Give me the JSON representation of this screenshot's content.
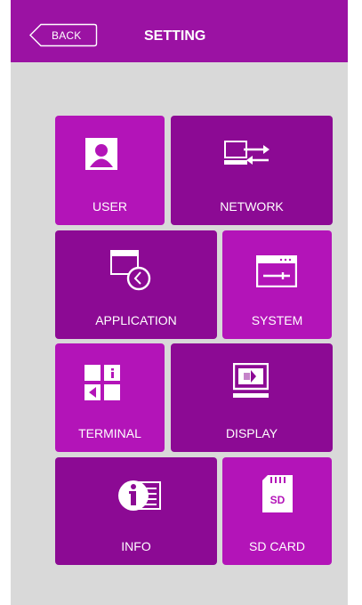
{
  "header": {
    "back_label": "BACK",
    "title": "SETTING",
    "background": "#9b12a3"
  },
  "tiles": [
    {
      "label": "USER",
      "icon": "user-icon"
    },
    {
      "label": "NETWORK",
      "icon": "network-icon"
    },
    {
      "label": "APPLICATION",
      "icon": "application-icon"
    },
    {
      "label": "SYSTEM",
      "icon": "system-icon"
    },
    {
      "label": "TERMINAL",
      "icon": "terminal-icon"
    },
    {
      "label": "DISPLAY",
      "icon": "display-icon"
    },
    {
      "label": "INFO",
      "icon": "info-icon"
    },
    {
      "label": "SD CARD",
      "icon": "sd-card-icon"
    }
  ],
  "colors": {
    "tile_light": "#b314b8",
    "tile_dark": "#8c0a94",
    "background": "#d9d9d9"
  }
}
